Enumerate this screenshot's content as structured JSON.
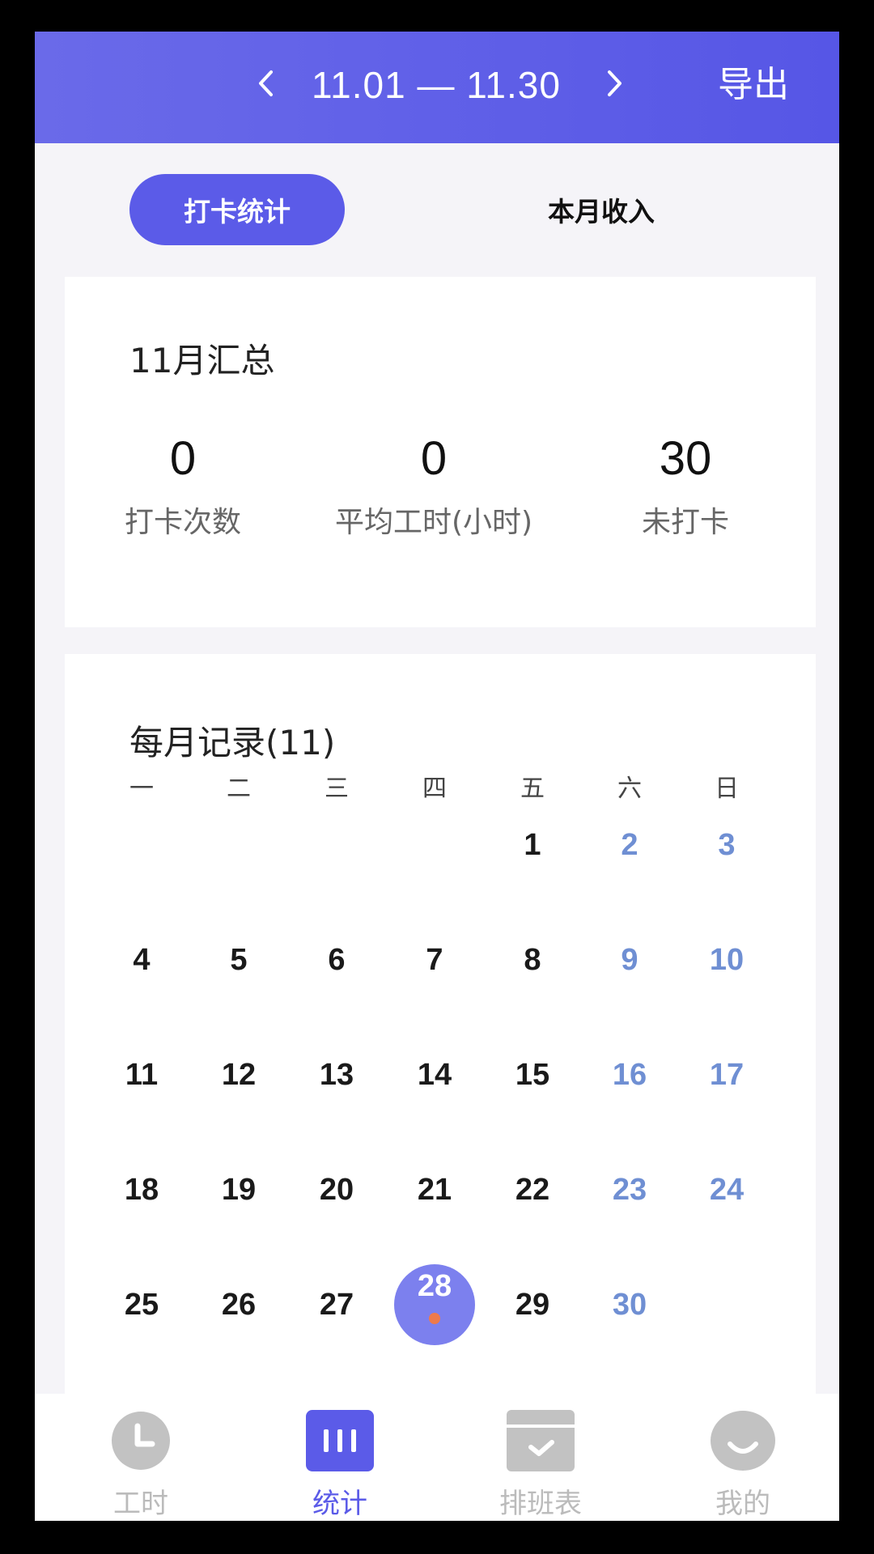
{
  "header": {
    "date_range": "11.01 — 11.30",
    "export_label": "导出",
    "bg_color": "#5b5be8"
  },
  "segments": {
    "items": [
      {
        "label": "打卡统计",
        "active": true
      },
      {
        "label": "本月收入",
        "active": false
      }
    ]
  },
  "summary": {
    "title": "11月汇总",
    "stats": [
      {
        "value": "0",
        "label": "打卡次数"
      },
      {
        "value": "0",
        "label": "平均工时(小时)"
      },
      {
        "value": "30",
        "label": "未打卡"
      }
    ]
  },
  "records": {
    "title": "每月记录(11)",
    "weekdays": [
      "一",
      "二",
      "三",
      "四",
      "五",
      "六",
      "日"
    ],
    "days": [
      "1",
      "2",
      "3",
      "4",
      "5",
      "6",
      "7",
      "8",
      "9",
      "10",
      "11",
      "12",
      "13",
      "14",
      "15",
      "16",
      "17",
      "18",
      "19",
      "20",
      "21",
      "22",
      "23",
      "24",
      "25",
      "26",
      "27",
      "28",
      "29",
      "30"
    ],
    "first_weekday_index": 4,
    "today": "28",
    "weekend_color": "#6f8fd3",
    "today_color": "#7c80ee",
    "dot_color": "#ee7a4b"
  },
  "tabbar": {
    "items": [
      {
        "label": "工时",
        "icon": "clock-icon",
        "active": false
      },
      {
        "label": "统计",
        "icon": "stats-icon",
        "active": true
      },
      {
        "label": "排班表",
        "icon": "schedule-icon",
        "active": false
      },
      {
        "label": "我的",
        "icon": "profile-icon",
        "active": false
      }
    ],
    "active_color": "#5b5be8",
    "inactive_color": "#bbbbbb"
  }
}
